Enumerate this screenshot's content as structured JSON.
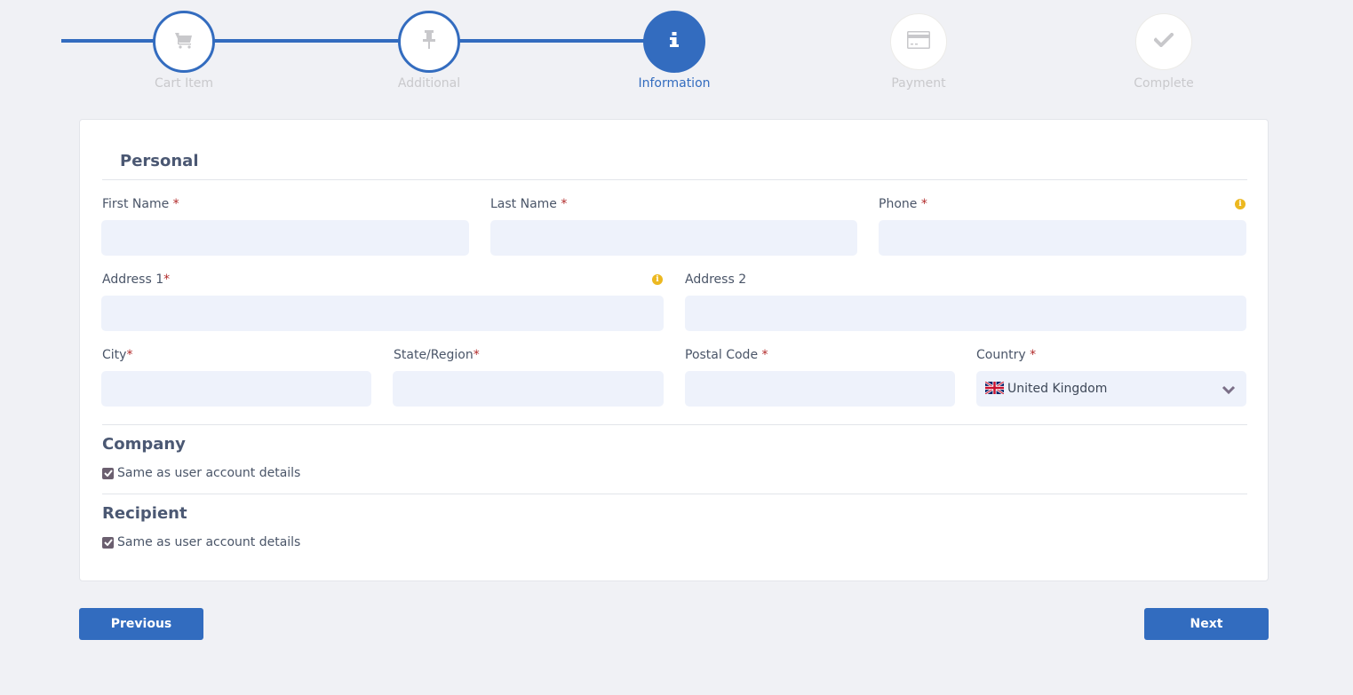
{
  "stepper": {
    "steps": [
      {
        "label": "Cart Item",
        "icon": "cart-icon",
        "state": "done"
      },
      {
        "label": "Additional",
        "icon": "pin-icon",
        "state": "done"
      },
      {
        "label": "Information",
        "icon": "info-icon",
        "state": "active"
      },
      {
        "label": "Payment",
        "icon": "credit-card-icon",
        "state": "todo"
      },
      {
        "label": "Complete",
        "icon": "check-icon",
        "state": "todo"
      }
    ]
  },
  "personal": {
    "title": "Personal",
    "fields": {
      "first_name": {
        "label": "First Name ",
        "required": "*",
        "value": ""
      },
      "last_name": {
        "label": "Last Name ",
        "required": "*",
        "value": ""
      },
      "phone": {
        "label": "Phone ",
        "required": "*",
        "value": "",
        "has_info": true
      },
      "address1": {
        "label": "Address 1",
        "required": "*",
        "value": "",
        "has_info": true
      },
      "address2": {
        "label": "Address 2",
        "required": "",
        "value": ""
      },
      "city": {
        "label": "City",
        "required": "*",
        "value": ""
      },
      "state": {
        "label": "State/Region",
        "required": "*",
        "value": ""
      },
      "postal": {
        "label": "Postal Code ",
        "required": "*",
        "value": ""
      },
      "country": {
        "label": "Country ",
        "required": "*",
        "value": "United Kingdom",
        "flag": "uk-flag"
      }
    }
  },
  "company": {
    "title": "Company",
    "same_as_account": {
      "label": "Same as user account details",
      "checked": true
    }
  },
  "recipient": {
    "title": "Recipient",
    "same_as_account": {
      "label": "Same as user account details",
      "checked": true
    }
  },
  "buttons": {
    "previous": "Previous",
    "next": "Next"
  },
  "colors": {
    "accent": "#336cbf",
    "info": "#ecb820",
    "required": "#b12a2a",
    "input_bg": "#eef2fb"
  }
}
